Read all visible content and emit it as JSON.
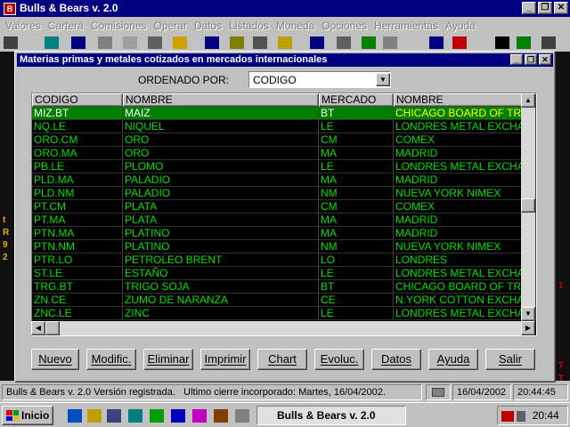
{
  "app": {
    "title": "Bulls & Bears v. 2.0",
    "icon_label": "B"
  },
  "window_controls": {
    "minimize": "_",
    "restore": "❐",
    "close": "✕"
  },
  "menu": [
    "Valores",
    "Cartera",
    "Comisiones",
    "Operar",
    "Datos",
    "Listados",
    "Moneda",
    "Opciones",
    "Herramientas",
    "Ayuda"
  ],
  "background_tickers": {
    "left": [
      "t",
      "R",
      "9",
      "2"
    ],
    "right": [
      "1",
      "T",
      "T"
    ]
  },
  "dialog": {
    "title": "Materias primas y metales cotizados en mercados internacionales",
    "order_label": "ORDENADO POR:",
    "order_value": "CODIGO",
    "columns": [
      "CODIGO",
      "NOMBRE",
      "MERCADO",
      "NOMBRE"
    ],
    "rows": [
      [
        "MIZ.BT",
        "MAIZ",
        "BT",
        "CHICAGO BOARD OF TR"
      ],
      [
        "NQ.LE",
        "NIQUEL",
        "LE",
        "LONDRES METAL EXCHA"
      ],
      [
        "ORO.CM",
        "ORO",
        "CM",
        "COMEX"
      ],
      [
        "ORO.MA",
        "ORO",
        "MA",
        "MADRID"
      ],
      [
        "PB.LE",
        "PLOMO",
        "LE",
        "LONDRES METAL EXCHA"
      ],
      [
        "PLD.MA",
        "PALADIO",
        "MA",
        "MADRID"
      ],
      [
        "PLD.NM",
        "PALADIO",
        "NM",
        "NUEVA YORK NIMEX"
      ],
      [
        "PT.CM",
        "PLATA",
        "CM",
        "COMEX"
      ],
      [
        "PT.MA",
        "PLATA",
        "MA",
        "MADRID"
      ],
      [
        "PTN.MA",
        "PLATINO",
        "MA",
        "MADRID"
      ],
      [
        "PTN.NM",
        "PLATINO",
        "NM",
        "NUEVA YORK NIMEX"
      ],
      [
        "PTR.LO",
        "PETROLEO BRENT",
        "LO",
        "LONDRES"
      ],
      [
        "ST.LE",
        "ESTAÑO",
        "LE",
        "LONDRES METAL EXCHA"
      ],
      [
        "TRG.BT",
        "TRIGO SOJA",
        "BT",
        "CHICAGO BOARD OF TR"
      ],
      [
        "ZN.CE",
        "ZUMO DE NARANZA",
        "CE",
        "N.YORK COTTON EXCHA"
      ],
      [
        "ZNC.LE",
        "ZINC",
        "LE",
        "LONDRES METAL EXCHA"
      ]
    ],
    "selected_row": 0,
    "buttons": [
      "Nuevo",
      "Modific.",
      "Eliminar",
      "Imprimir",
      "Chart",
      "Evoluc.",
      "Datos",
      "Ayuda",
      "Salir"
    ]
  },
  "statusbar": {
    "app": "Bulls & Bears v. 2.0  Versión registrada.",
    "last_close": "Ultimo cierre incorporado: Martes, 16/04/2002.",
    "date": "16/04/2002",
    "time": "20:44:45"
  },
  "taskbar": {
    "start_label": "Inicio",
    "task_label": "Bulls & Bears v. 2.0",
    "clock": "20:44"
  },
  "colors": {
    "titlebar": "#000080",
    "grid_text": "#00e000",
    "grid_selected": "#008000"
  }
}
